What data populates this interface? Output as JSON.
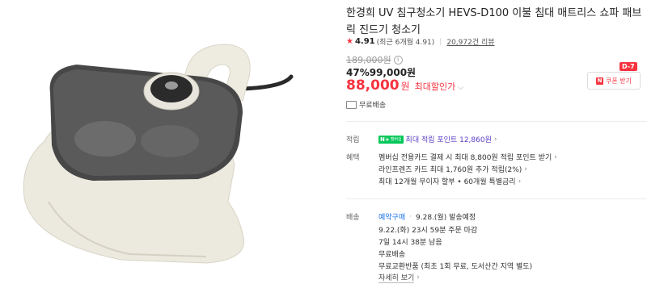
{
  "product": {
    "title": "한경희 UV 침구청소기 HEVS-D100 이불 침대 매트리스 쇼파 패브릭 진드기 청소기",
    "image_alt": "product-photo-bedding-vacuum"
  },
  "rating": {
    "score": "4.91",
    "recent": "(최근 6개월 4.91",
    "reviews": "20,972건 리뷰"
  },
  "price": {
    "original": "189,000원",
    "discount_pct": "47%",
    "discount_price": "99,000원",
    "final": "88,000",
    "final_unit": "원",
    "max_discount": "최대할인가"
  },
  "coupon": {
    "tag": "D-7",
    "icon": "N",
    "label": "쿠폰 받기"
  },
  "shipping": {
    "free": "무료배송"
  },
  "benefits": {
    "points_label": "적립",
    "npay_badge": "N+",
    "npay_small": "멤버십",
    "points_text": "최대 적립 포인트 12,860원",
    "benefit_label": "혜택",
    "lines": [
      "멤버십 전용카드 결제 시 최대 8,800원 적립 포인트 받기",
      "라인프렌즈 카드 최대 1,760원 추가 적립(2%)",
      "최대 12개월 무이자 할부 • 60개월 특별금리"
    ]
  },
  "delivery": {
    "label": "배송",
    "reserve": "예약구매",
    "ship_date": "9.28.(월) 발송예정",
    "order_deadline": "9.22.(화) 23시 59분 주문 마감",
    "remaining": "7일 14시 38분 남음",
    "free": "무료배송",
    "returns": "무료교환반품 (최초 1회 무료, 도서산간 지역 별도)",
    "more": "자세히 보기"
  }
}
